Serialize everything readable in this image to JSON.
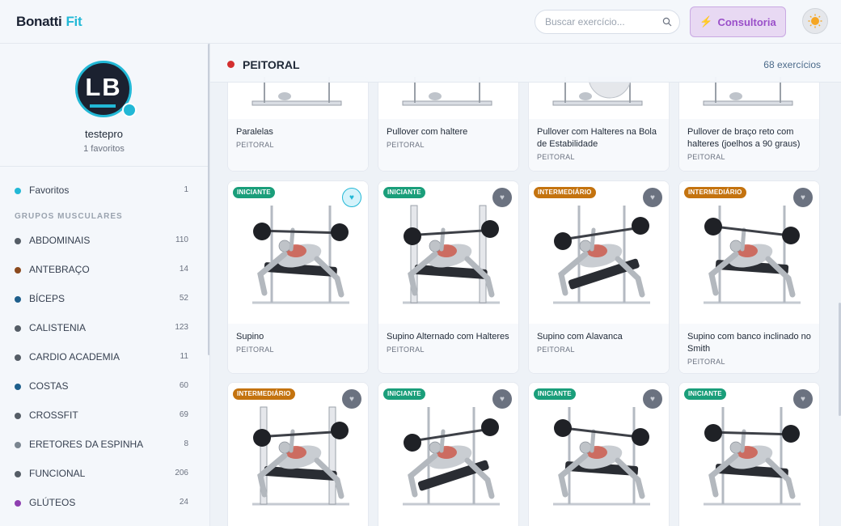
{
  "brand": {
    "part1": "Bonatti",
    "part2": "Fit"
  },
  "search": {
    "placeholder": "Buscar exercício..."
  },
  "consult_button": {
    "label": "Consultoria"
  },
  "profile": {
    "logo_text": "LB",
    "username": "testepro",
    "favorites_text": "1 favoritos"
  },
  "favorites_row": {
    "label": "Favoritos",
    "count": "1",
    "color": "#22b8d6"
  },
  "muscle_groups_label": "GRUPOS MUSCULARES",
  "muscle_groups": [
    {
      "label": "ABDOMINAIS",
      "count": "110",
      "color": "#555d66"
    },
    {
      "label": "ANTEBRAÇO",
      "count": "14",
      "color": "#8b4a1e"
    },
    {
      "label": "BÍCEPS",
      "count": "52",
      "color": "#1e5f8c"
    },
    {
      "label": "CALISTENIA",
      "count": "123",
      "color": "#555d66"
    },
    {
      "label": "CARDIO ACADEMIA",
      "count": "11",
      "color": "#555d66"
    },
    {
      "label": "COSTAS",
      "count": "60",
      "color": "#1e5f8c"
    },
    {
      "label": "CROSSFIT",
      "count": "69",
      "color": "#555d66"
    },
    {
      "label": "ERETORES DA ESPINHA",
      "count": "8",
      "color": "#7a8590"
    },
    {
      "label": "FUNCIONAL",
      "count": "206",
      "color": "#555d66"
    },
    {
      "label": "GLÚTEOS",
      "count": "24",
      "color": "#8e3fb0"
    }
  ],
  "category": {
    "title": "PEITORAL",
    "count_text": "68 exercícios",
    "color": "#d32f2f"
  },
  "exercises_row1": [
    {
      "name": "Paralelas",
      "category": "PEITORAL"
    },
    {
      "name": "Pullover com haltere",
      "category": "PEITORAL"
    },
    {
      "name": "Pullover com Halteres na Bola de Estabilidade",
      "category": "PEITORAL"
    },
    {
      "name": "Pullover de braço reto com halteres (joelhos a 90 graus)",
      "category": "PEITORAL"
    }
  ],
  "exercises_row2": [
    {
      "name": "Supino",
      "category": "PEITORAL",
      "level": "INICIANTE",
      "favorite": true
    },
    {
      "name": "Supino Alternado com Halteres",
      "category": "PEITORAL",
      "level": "INICIANTE",
      "favorite": false
    },
    {
      "name": "Supino com Alavanca",
      "category": "PEITORAL",
      "level": "INTERMEDIÁRIO",
      "favorite": false
    },
    {
      "name": "Supino com banco inclinado no Smith",
      "category": "PEITORAL",
      "level": "INTERMEDIÁRIO",
      "favorite": false
    }
  ],
  "exercises_row3": [
    {
      "level": "INTERMEDIÁRIO",
      "favorite": false
    },
    {
      "level": "INICIANTE",
      "favorite": false
    },
    {
      "level": "INICIANTE",
      "favorite": false
    },
    {
      "level": "INICIANTE",
      "favorite": false
    }
  ],
  "colors": {
    "accent": "#22b8d6",
    "beginner": "#1a9e7a",
    "intermediate": "#c4730f",
    "consult": "#9a4fc9"
  }
}
